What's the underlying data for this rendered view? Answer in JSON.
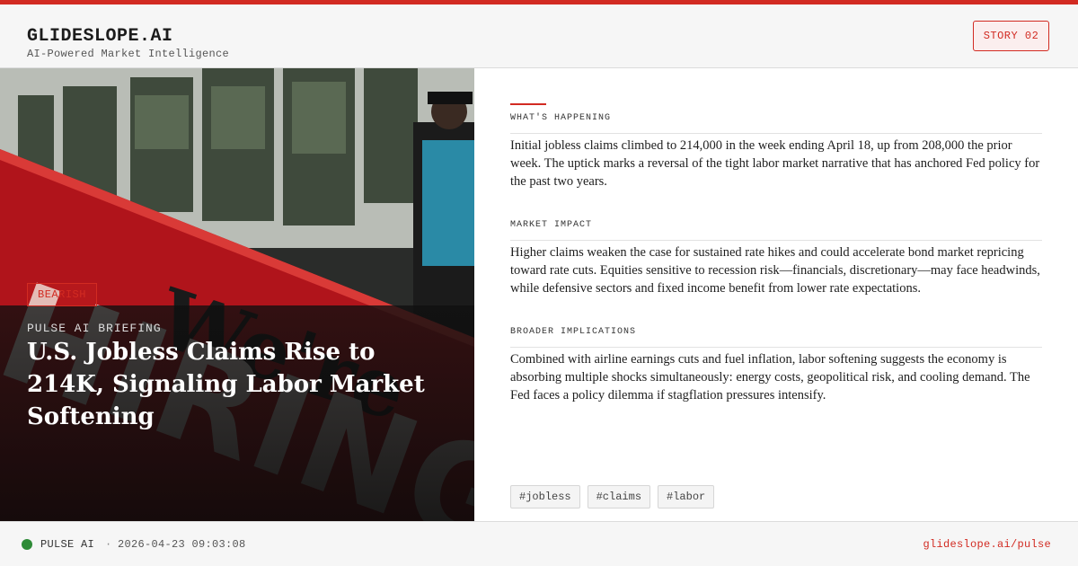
{
  "brand": {
    "name": "GLIDESLOPE.AI",
    "tagline": "AI-Powered Market Intelligence",
    "story_badge": "STORY 02"
  },
  "hero": {
    "tone_badge": "BEARISH",
    "kicker": "PULSE AI BRIEFING",
    "headline": "U.S. Jobless Claims Rise to 214K, Signaling Labor Market Softening",
    "photo_sign_text": "We're",
    "photo_sign_text2": "HIRING"
  },
  "sections": [
    {
      "label": "WHAT'S HAPPENING",
      "body": "Initial jobless claims climbed to 214,000 in the week ending April 18, up from 208,000 the prior week. The uptick marks a reversal of the tight labor market narrative that has anchored Fed policy for the past two years."
    },
    {
      "label": "MARKET IMPACT",
      "body": "Higher claims weaken the case for sustained rate hikes and could accelerate bond market repricing toward rate cuts. Equities sensitive to recession risk—financials, discretionary—may face headwinds, while defensive sectors and fixed income benefit from lower rate expectations."
    },
    {
      "label": "BROADER IMPLICATIONS",
      "body": "Combined with airline earnings cuts and fuel inflation, labor softening suggests the economy is absorbing multiple shocks simultaneously: energy costs, geopolitical risk, and cooling demand. The Fed faces a policy dilemma if stagflation pressures intensify."
    }
  ],
  "tags": [
    "#jobless",
    "#claims",
    "#labor"
  ],
  "footer": {
    "source": "PULSE AI",
    "separator": "·",
    "timestamp": "2026-04-23 09:03:08",
    "url": "glideslope.ai/pulse"
  },
  "colors": {
    "accent": "#d22b22",
    "live": "#2e8b37"
  }
}
